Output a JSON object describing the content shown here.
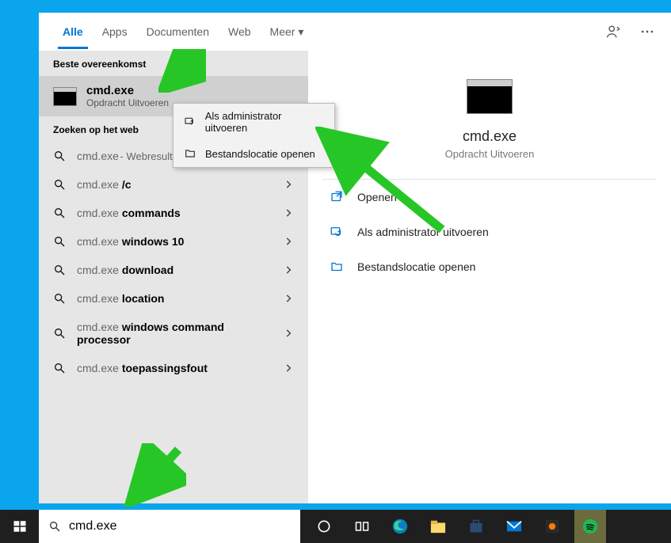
{
  "tabs": {
    "all": "Alle",
    "apps": "Apps",
    "documents": "Documenten",
    "web": "Web",
    "more": "Meer"
  },
  "sections": {
    "best": "Beste overeenkomst",
    "web": "Zoeken op het web"
  },
  "bestMatch": {
    "title": "cmd.exe",
    "sub": "Opdracht Uitvoeren"
  },
  "webResults": [
    {
      "prefix": "cmd.exe",
      "suffix": " - Webresultaten weergeven",
      "bold": false
    },
    {
      "prefix": "cmd.exe ",
      "suffix": "/c",
      "bold": true
    },
    {
      "prefix": "cmd.exe ",
      "suffix": "commands",
      "bold": true
    },
    {
      "prefix": "cmd.exe ",
      "suffix": "windows 10",
      "bold": true
    },
    {
      "prefix": "cmd.exe ",
      "suffix": "download",
      "bold": true
    },
    {
      "prefix": "cmd.exe ",
      "suffix": "location",
      "bold": true
    },
    {
      "prefix": "cmd.exe ",
      "suffix": "windows command processor",
      "bold": true
    },
    {
      "prefix": "cmd.exe ",
      "suffix": "toepassingsfout",
      "bold": true
    }
  ],
  "preview": {
    "title": "cmd.exe",
    "sub": "Opdracht Uitvoeren"
  },
  "actions": {
    "open": "Openen",
    "admin": "Als administrator uitvoeren",
    "loc": "Bestandslocatie openen"
  },
  "context": {
    "admin": "Als administrator uitvoeren",
    "loc": "Bestandslocatie openen"
  },
  "search": {
    "value": "cmd.exe"
  },
  "colors": {
    "accent": "#0078d4",
    "desktop": "#0ba5ed",
    "arrow": "#27c627"
  },
  "icons": {
    "search": "search-icon",
    "chevron": "chevron-right-icon",
    "person": "person-icon",
    "more": "more-icon",
    "caret": "caret-down-icon",
    "open": "open-icon",
    "shield": "shield-icon",
    "folder": "folder-icon"
  }
}
